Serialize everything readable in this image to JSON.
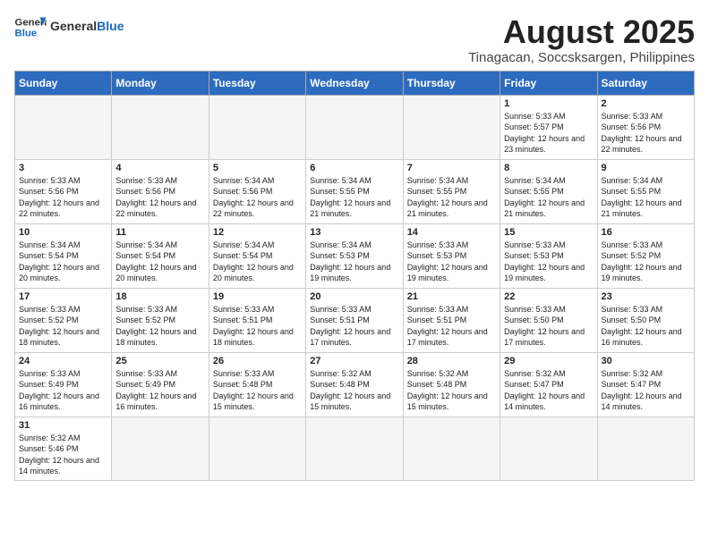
{
  "header": {
    "logo_text_general": "General",
    "logo_text_blue": "Blue",
    "month_title": "August 2025",
    "subtitle": "Tinagacan, Soccsksargen, Philippines"
  },
  "days_of_week": [
    "Sunday",
    "Monday",
    "Tuesday",
    "Wednesday",
    "Thursday",
    "Friday",
    "Saturday"
  ],
  "weeks": [
    [
      {
        "day": "",
        "info": ""
      },
      {
        "day": "",
        "info": ""
      },
      {
        "day": "",
        "info": ""
      },
      {
        "day": "",
        "info": ""
      },
      {
        "day": "",
        "info": ""
      },
      {
        "day": "1",
        "info": "Sunrise: 5:33 AM\nSunset: 5:57 PM\nDaylight: 12 hours\nand 23 minutes."
      },
      {
        "day": "2",
        "info": "Sunrise: 5:33 AM\nSunset: 5:56 PM\nDaylight: 12 hours\nand 22 minutes."
      }
    ],
    [
      {
        "day": "3",
        "info": "Sunrise: 5:33 AM\nSunset: 5:56 PM\nDaylight: 12 hours\nand 22 minutes."
      },
      {
        "day": "4",
        "info": "Sunrise: 5:33 AM\nSunset: 5:56 PM\nDaylight: 12 hours\nand 22 minutes."
      },
      {
        "day": "5",
        "info": "Sunrise: 5:34 AM\nSunset: 5:56 PM\nDaylight: 12 hours\nand 22 minutes."
      },
      {
        "day": "6",
        "info": "Sunrise: 5:34 AM\nSunset: 5:55 PM\nDaylight: 12 hours\nand 21 minutes."
      },
      {
        "day": "7",
        "info": "Sunrise: 5:34 AM\nSunset: 5:55 PM\nDaylight: 12 hours\nand 21 minutes."
      },
      {
        "day": "8",
        "info": "Sunrise: 5:34 AM\nSunset: 5:55 PM\nDaylight: 12 hours\nand 21 minutes."
      },
      {
        "day": "9",
        "info": "Sunrise: 5:34 AM\nSunset: 5:55 PM\nDaylight: 12 hours\nand 21 minutes."
      }
    ],
    [
      {
        "day": "10",
        "info": "Sunrise: 5:34 AM\nSunset: 5:54 PM\nDaylight: 12 hours\nand 20 minutes."
      },
      {
        "day": "11",
        "info": "Sunrise: 5:34 AM\nSunset: 5:54 PM\nDaylight: 12 hours\nand 20 minutes."
      },
      {
        "day": "12",
        "info": "Sunrise: 5:34 AM\nSunset: 5:54 PM\nDaylight: 12 hours\nand 20 minutes."
      },
      {
        "day": "13",
        "info": "Sunrise: 5:34 AM\nSunset: 5:53 PM\nDaylight: 12 hours\nand 19 minutes."
      },
      {
        "day": "14",
        "info": "Sunrise: 5:33 AM\nSunset: 5:53 PM\nDaylight: 12 hours\nand 19 minutes."
      },
      {
        "day": "15",
        "info": "Sunrise: 5:33 AM\nSunset: 5:53 PM\nDaylight: 12 hours\nand 19 minutes."
      },
      {
        "day": "16",
        "info": "Sunrise: 5:33 AM\nSunset: 5:52 PM\nDaylight: 12 hours\nand 19 minutes."
      }
    ],
    [
      {
        "day": "17",
        "info": "Sunrise: 5:33 AM\nSunset: 5:52 PM\nDaylight: 12 hours\nand 18 minutes."
      },
      {
        "day": "18",
        "info": "Sunrise: 5:33 AM\nSunset: 5:52 PM\nDaylight: 12 hours\nand 18 minutes."
      },
      {
        "day": "19",
        "info": "Sunrise: 5:33 AM\nSunset: 5:51 PM\nDaylight: 12 hours\nand 18 minutes."
      },
      {
        "day": "20",
        "info": "Sunrise: 5:33 AM\nSunset: 5:51 PM\nDaylight: 12 hours\nand 17 minutes."
      },
      {
        "day": "21",
        "info": "Sunrise: 5:33 AM\nSunset: 5:51 PM\nDaylight: 12 hours\nand 17 minutes."
      },
      {
        "day": "22",
        "info": "Sunrise: 5:33 AM\nSunset: 5:50 PM\nDaylight: 12 hours\nand 17 minutes."
      },
      {
        "day": "23",
        "info": "Sunrise: 5:33 AM\nSunset: 5:50 PM\nDaylight: 12 hours\nand 16 minutes."
      }
    ],
    [
      {
        "day": "24",
        "info": "Sunrise: 5:33 AM\nSunset: 5:49 PM\nDaylight: 12 hours\nand 16 minutes."
      },
      {
        "day": "25",
        "info": "Sunrise: 5:33 AM\nSunset: 5:49 PM\nDaylight: 12 hours\nand 16 minutes."
      },
      {
        "day": "26",
        "info": "Sunrise: 5:33 AM\nSunset: 5:48 PM\nDaylight: 12 hours\nand 15 minutes."
      },
      {
        "day": "27",
        "info": "Sunrise: 5:32 AM\nSunset: 5:48 PM\nDaylight: 12 hours\nand 15 minutes."
      },
      {
        "day": "28",
        "info": "Sunrise: 5:32 AM\nSunset: 5:48 PM\nDaylight: 12 hours\nand 15 minutes."
      },
      {
        "day": "29",
        "info": "Sunrise: 5:32 AM\nSunset: 5:47 PM\nDaylight: 12 hours\nand 14 minutes."
      },
      {
        "day": "30",
        "info": "Sunrise: 5:32 AM\nSunset: 5:47 PM\nDaylight: 12 hours\nand 14 minutes."
      }
    ],
    [
      {
        "day": "31",
        "info": "Sunrise: 5:32 AM\nSunset: 5:46 PM\nDaylight: 12 hours\nand 14 minutes."
      },
      {
        "day": "",
        "info": ""
      },
      {
        "day": "",
        "info": ""
      },
      {
        "day": "",
        "info": ""
      },
      {
        "day": "",
        "info": ""
      },
      {
        "day": "",
        "info": ""
      },
      {
        "day": "",
        "info": ""
      }
    ]
  ]
}
